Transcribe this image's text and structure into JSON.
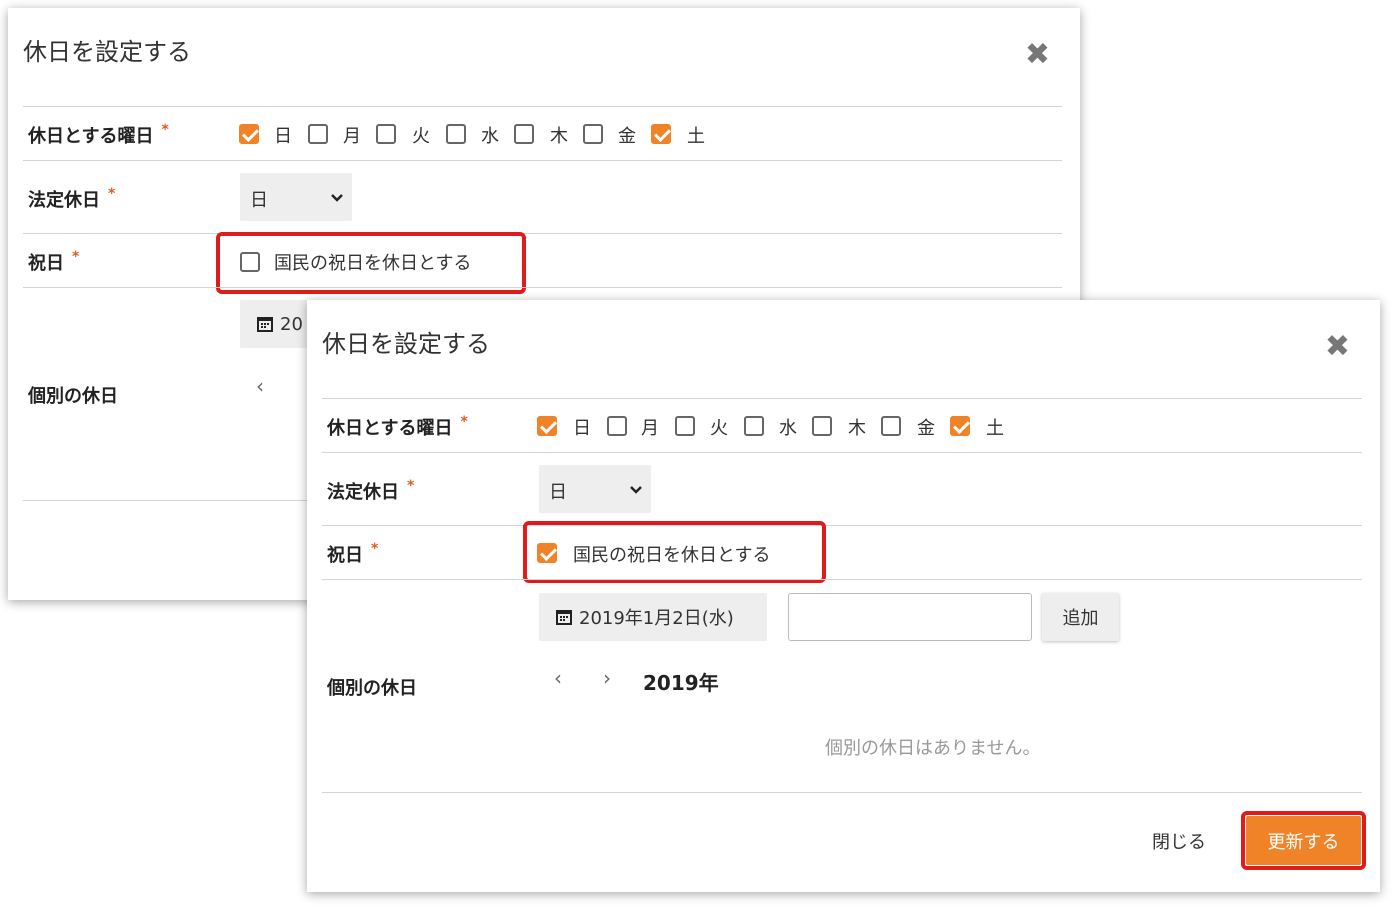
{
  "dialog_back": {
    "title": "休日を設定する",
    "close_icon": "✖",
    "weekday_label": "休日とする曜日",
    "required_mark": "*",
    "weekdays": [
      {
        "label": "日",
        "checked": true
      },
      {
        "label": "月",
        "checked": false
      },
      {
        "label": "火",
        "checked": false
      },
      {
        "label": "水",
        "checked": false
      },
      {
        "label": "木",
        "checked": false
      },
      {
        "label": "金",
        "checked": false
      },
      {
        "label": "土",
        "checked": true
      }
    ],
    "legal_holiday_label": "法定休日",
    "legal_holiday_value": "日",
    "national_holiday_label": "祝日",
    "national_holiday_option": "国民の祝日を休日とする",
    "national_holiday_checked": false,
    "date_partial": "20",
    "individual_label": "個別の休日"
  },
  "dialog_front": {
    "title": "休日を設定する",
    "close_icon": "✖",
    "weekday_label": "休日とする曜日",
    "required_mark": "*",
    "weekdays": [
      {
        "label": "日",
        "checked": true
      },
      {
        "label": "月",
        "checked": false
      },
      {
        "label": "火",
        "checked": false
      },
      {
        "label": "水",
        "checked": false
      },
      {
        "label": "木",
        "checked": false
      },
      {
        "label": "金",
        "checked": false
      },
      {
        "label": "土",
        "checked": true
      }
    ],
    "legal_holiday_label": "法定休日",
    "legal_holiday_value": "日",
    "national_holiday_label": "祝日",
    "national_holiday_option": "国民の祝日を休日とする",
    "national_holiday_checked": true,
    "date_button": "2019年1月2日(水)",
    "add_button": "追加",
    "individual_label": "個別の休日",
    "prev_icon": "‹",
    "next_icon": "›",
    "year": "2019年",
    "empty_message": "個別の休日はありません。",
    "close_button": "閉じる",
    "update_button": "更新する"
  },
  "colors": {
    "accent": "#f08228",
    "highlight": "#e01b1b",
    "required": "#e05a1f"
  }
}
